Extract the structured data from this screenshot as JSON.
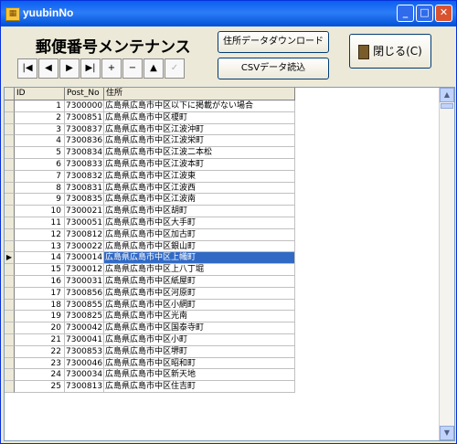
{
  "window": {
    "title": "yuubinNo",
    "title_icon": "app-icon",
    "controls": [
      "_",
      "□",
      "✕"
    ]
  },
  "heading": "郵便番号メンテナンス",
  "nav_buttons": [
    "|◀",
    "◀",
    "▶",
    "▶|",
    "+",
    "−",
    "▲",
    "✓"
  ],
  "buttons": {
    "download": "住所データダウンロード",
    "csv": "CSVデータ読込",
    "close": "閉じる(C)"
  },
  "grid": {
    "columns": [
      "ID",
      "Post_No",
      "住所"
    ],
    "selected_id": 14,
    "rows": [
      {
        "id": "1",
        "post": "7300000",
        "addr": "広島県広島市中区以下に掲載がない場合"
      },
      {
        "id": "2",
        "post": "7300851",
        "addr": "広島県広島市中区榎町"
      },
      {
        "id": "3",
        "post": "7300837",
        "addr": "広島県広島市中区江波沖町"
      },
      {
        "id": "4",
        "post": "7300836",
        "addr": "広島県広島市中区江波栄町"
      },
      {
        "id": "5",
        "post": "7300834",
        "addr": "広島県広島市中区江波二本松"
      },
      {
        "id": "6",
        "post": "7300833",
        "addr": "広島県広島市中区江波本町"
      },
      {
        "id": "7",
        "post": "7300832",
        "addr": "広島県広島市中区江波東"
      },
      {
        "id": "8",
        "post": "7300831",
        "addr": "広島県広島市中区江波西"
      },
      {
        "id": "9",
        "post": "7300835",
        "addr": "広島県広島市中区江波南"
      },
      {
        "id": "10",
        "post": "7300021",
        "addr": "広島県広島市中区胡町"
      },
      {
        "id": "11",
        "post": "7300051",
        "addr": "広島県広島市中区大手町"
      },
      {
        "id": "12",
        "post": "7300812",
        "addr": "広島県広島市中区加古町"
      },
      {
        "id": "13",
        "post": "7300022",
        "addr": "広島県広島市中区銀山町"
      },
      {
        "id": "14",
        "post": "7300014",
        "addr": "広島県広島市中区上幟町"
      },
      {
        "id": "15",
        "post": "7300012",
        "addr": "広島県広島市中区上八丁堀"
      },
      {
        "id": "16",
        "post": "7300031",
        "addr": "広島県広島市中区紙屋町"
      },
      {
        "id": "17",
        "post": "7300856",
        "addr": "広島県広島市中区河原町"
      },
      {
        "id": "18",
        "post": "7300855",
        "addr": "広島県広島市中区小網町"
      },
      {
        "id": "19",
        "post": "7300825",
        "addr": "広島県広島市中区光南"
      },
      {
        "id": "20",
        "post": "7300042",
        "addr": "広島県広島市中区国泰寺町"
      },
      {
        "id": "21",
        "post": "7300041",
        "addr": "広島県広島市中区小町"
      },
      {
        "id": "22",
        "post": "7300853",
        "addr": "広島県広島市中区堺町"
      },
      {
        "id": "23",
        "post": "7300046",
        "addr": "広島県広島市中区昭和町"
      },
      {
        "id": "24",
        "post": "7300034",
        "addr": "広島県広島市中区新天地"
      },
      {
        "id": "25",
        "post": "7300813",
        "addr": "広島県広島市中区住吉町"
      }
    ]
  }
}
